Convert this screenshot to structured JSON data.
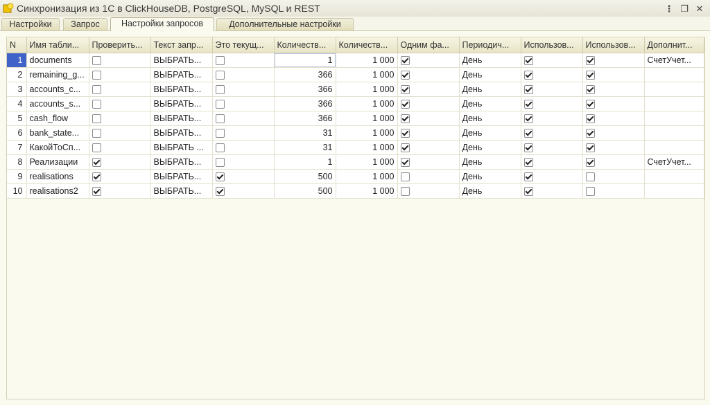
{
  "window": {
    "title": "Синхронизация из 1С в ClickHouseDB, PostgreSQL, MySQL и REST",
    "icon": "1c-app-icon",
    "controls": [
      "more-icon",
      "restore-icon",
      "close-icon"
    ]
  },
  "tabs": [
    {
      "label": "Настройки",
      "active": false
    },
    {
      "label": "Запрос",
      "active": false
    },
    {
      "label": "Настройки запросов",
      "active": true
    },
    {
      "label": "Дополнительные настройки",
      "active": false
    }
  ],
  "table": {
    "headers": [
      "N",
      "Имя табли...",
      "Проверить...",
      "Текст запр...",
      "Это текущ...",
      "Количеств...",
      "Количеств...",
      "Одним фа...",
      "Периодич...",
      "Использов...",
      "Использов...",
      "Дополнит..."
    ],
    "rows": [
      {
        "n": "1",
        "name": "documents",
        "check": false,
        "query": "ВЫБРАТЬ...",
        "current": false,
        "qty1": "1",
        "qty2": "1 000",
        "one_file": true,
        "period": "День",
        "use1": true,
        "use2": true,
        "extra": "СчетУчет...",
        "selected": true
      },
      {
        "n": "2",
        "name": "remaining_g...",
        "check": false,
        "query": "ВЫБРАТЬ...",
        "current": false,
        "qty1": "366",
        "qty2": "1 000",
        "one_file": true,
        "period": "День",
        "use1": true,
        "use2": true,
        "extra": "",
        "selected": false
      },
      {
        "n": "3",
        "name": "accounts_c...",
        "check": false,
        "query": "ВЫБРАТЬ...",
        "current": false,
        "qty1": "366",
        "qty2": "1 000",
        "one_file": true,
        "period": "День",
        "use1": true,
        "use2": true,
        "extra": "",
        "selected": false
      },
      {
        "n": "4",
        "name": "accounts_s...",
        "check": false,
        "query": "ВЫБРАТЬ...",
        "current": false,
        "qty1": "366",
        "qty2": "1 000",
        "one_file": true,
        "period": "День",
        "use1": true,
        "use2": true,
        "extra": "",
        "selected": false
      },
      {
        "n": "5",
        "name": "cash_flow",
        "check": false,
        "query": "ВЫБРАТЬ...",
        "current": false,
        "qty1": "366",
        "qty2": "1 000",
        "one_file": true,
        "period": "День",
        "use1": true,
        "use2": true,
        "extra": "",
        "selected": false
      },
      {
        "n": "6",
        "name": "bank_state...",
        "check": false,
        "query": "ВЫБРАТЬ...",
        "current": false,
        "qty1": "31",
        "qty2": "1 000",
        "one_file": true,
        "period": "День",
        "use1": true,
        "use2": true,
        "extra": "",
        "selected": false
      },
      {
        "n": "7",
        "name": "КакойТоСп...",
        "check": false,
        "query": "ВЫБРАТЬ ...",
        "current": false,
        "qty1": "31",
        "qty2": "1 000",
        "one_file": true,
        "period": "День",
        "use1": true,
        "use2": true,
        "extra": "",
        "selected": false
      },
      {
        "n": "8",
        "name": "Реализации",
        "check": true,
        "query": "ВЫБРАТЬ...",
        "current": false,
        "qty1": "1",
        "qty2": "1 000",
        "one_file": true,
        "period": "День",
        "use1": true,
        "use2": true,
        "extra": "СчетУчет...",
        "selected": false
      },
      {
        "n": "9",
        "name": "realisations",
        "check": true,
        "query": "ВЫБРАТЬ...",
        "current": true,
        "qty1": "500",
        "qty2": "1 000",
        "one_file": false,
        "period": "День",
        "use1": true,
        "use2": false,
        "extra": "",
        "selected": false
      },
      {
        "n": "10",
        "name": "realisations2",
        "check": true,
        "query": "ВЫБРАТЬ...",
        "current": true,
        "qty1": "500",
        "qty2": "1 000",
        "one_file": false,
        "period": "День",
        "use1": true,
        "use2": false,
        "extra": "",
        "selected": false
      }
    ]
  },
  "colors": {
    "accent": "#3f63c9",
    "background": "#fbfaef"
  }
}
